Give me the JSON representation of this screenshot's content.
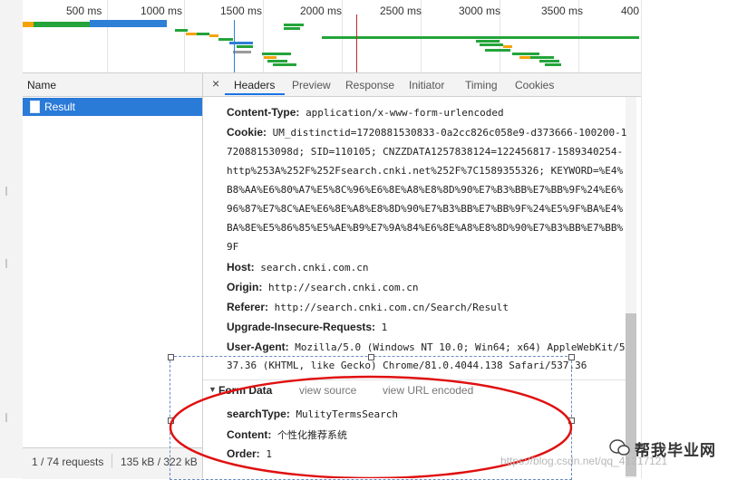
{
  "timeline": {
    "ticks": [
      "500 ms",
      "1000 ms",
      "1500 ms",
      "2000 ms",
      "2500 ms",
      "3000 ms",
      "3500 ms",
      "400"
    ]
  },
  "name_column": {
    "header": "Name",
    "selected_item": "Result"
  },
  "status_bar": {
    "requests": "1 / 74 requests",
    "transferred": "135 kB / 322 kB"
  },
  "tabs": [
    "Headers",
    "Preview",
    "Response",
    "Initiator",
    "Timing",
    "Cookies"
  ],
  "active_tab": "Headers",
  "close_label": "×",
  "request_headers": {
    "content_type_key": "Content-Type:",
    "content_type_val": "application/x-www-form-urlencoded",
    "cookie_key": "Cookie:",
    "cookie_lines": [
      "UM_distinctid=1720881530833-0a2cc826c058e9-d373666-100200-1",
      "72088153098d; SID=110105; CNZZDATA1257838124=122456817-1589340254-",
      "http%253A%252F%252Fsearch.cnki.net%252F%7C1589355326; KEYWORD=%E4%",
      "B8%AA%E6%80%A7%E5%8C%96%E6%8E%A8%E8%8D%90%E7%B3%BB%E7%BB%9F%24%E6%",
      "96%87%E7%8C%AE%E6%8E%A8%E8%8D%90%E7%B3%BB%E7%BB%9F%24%E5%9F%BA%E4%",
      "BA%8E%E5%86%85%E5%AE%B9%E7%9A%84%E6%8E%A8%E8%8D%90%E7%B3%BB%E7%BB%",
      "9F"
    ],
    "host_key": "Host:",
    "host_val": "search.cnki.com.cn",
    "origin_key": "Origin:",
    "origin_val": "http://search.cnki.com.cn",
    "referer_key": "Referer:",
    "referer_val": "http://search.cnki.com.cn/Search/Result",
    "upgrade_key": "Upgrade-Insecure-Requests:",
    "upgrade_val": "1",
    "ua_key": "User-Agent:",
    "ua_line1": "Mozilla/5.0 (Windows NT 10.0; Win64; x64) AppleWebKit/5",
    "ua_line2": "37.36 (KHTML, like Gecko) Chrome/81.0.4044.138 Safari/537.36"
  },
  "form_data": {
    "title": "Form Data",
    "view_source": "view source",
    "view_url_encoded": "view URL encoded",
    "search_type_key": "searchType:",
    "search_type_val": "MulityTermsSearch",
    "content_key": "Content:",
    "content_val": "个性化推荐系统",
    "order_key": "Order:",
    "order_val": "1"
  },
  "watermark": {
    "text": "帮我毕业网",
    "url": "https://blog.csdn.net/qq_41217121"
  },
  "colors": {
    "selection_blue": "#2a7ad8",
    "annotation_red": "#e01010",
    "active_tab_underline": "#1a73e8"
  }
}
